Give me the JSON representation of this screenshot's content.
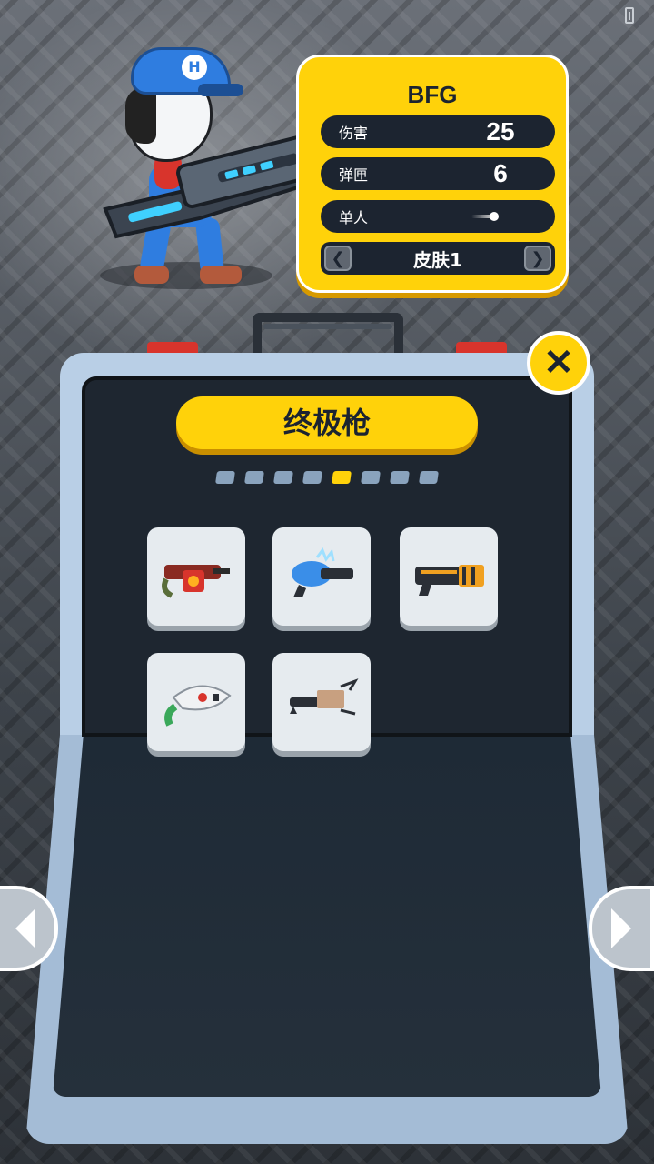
{
  "weapon": {
    "name": "BFG",
    "stats": [
      {
        "label": "伤害",
        "value": "25"
      },
      {
        "label": "弹匣",
        "value": "6"
      },
      {
        "label": "单人",
        "icon": "single-shot-icon"
      }
    ],
    "skin": {
      "label": "皮肤1",
      "prev_icon": "chevron-left-icon",
      "next_icon": "chevron-right-icon"
    }
  },
  "category": {
    "title": "终极枪",
    "pages_total": 8,
    "active_page": 5
  },
  "close_icon": "close-icon",
  "weapons_grid": [
    {
      "icon": "flame-gun-icon"
    },
    {
      "icon": "ice-blaster-icon"
    },
    {
      "icon": "gatling-blaster-icon"
    },
    {
      "icon": "alien-raygun-icon"
    },
    {
      "icon": "harpoon-launcher-icon"
    }
  ],
  "nav": {
    "left_icon": "arrow-left-icon",
    "right_icon": "arrow-right-icon"
  },
  "colors": {
    "accent": "#ffd20a",
    "panel_dark": "#1c2430",
    "case_light": "#b9cfe6",
    "latch_red": "#d8342c"
  }
}
